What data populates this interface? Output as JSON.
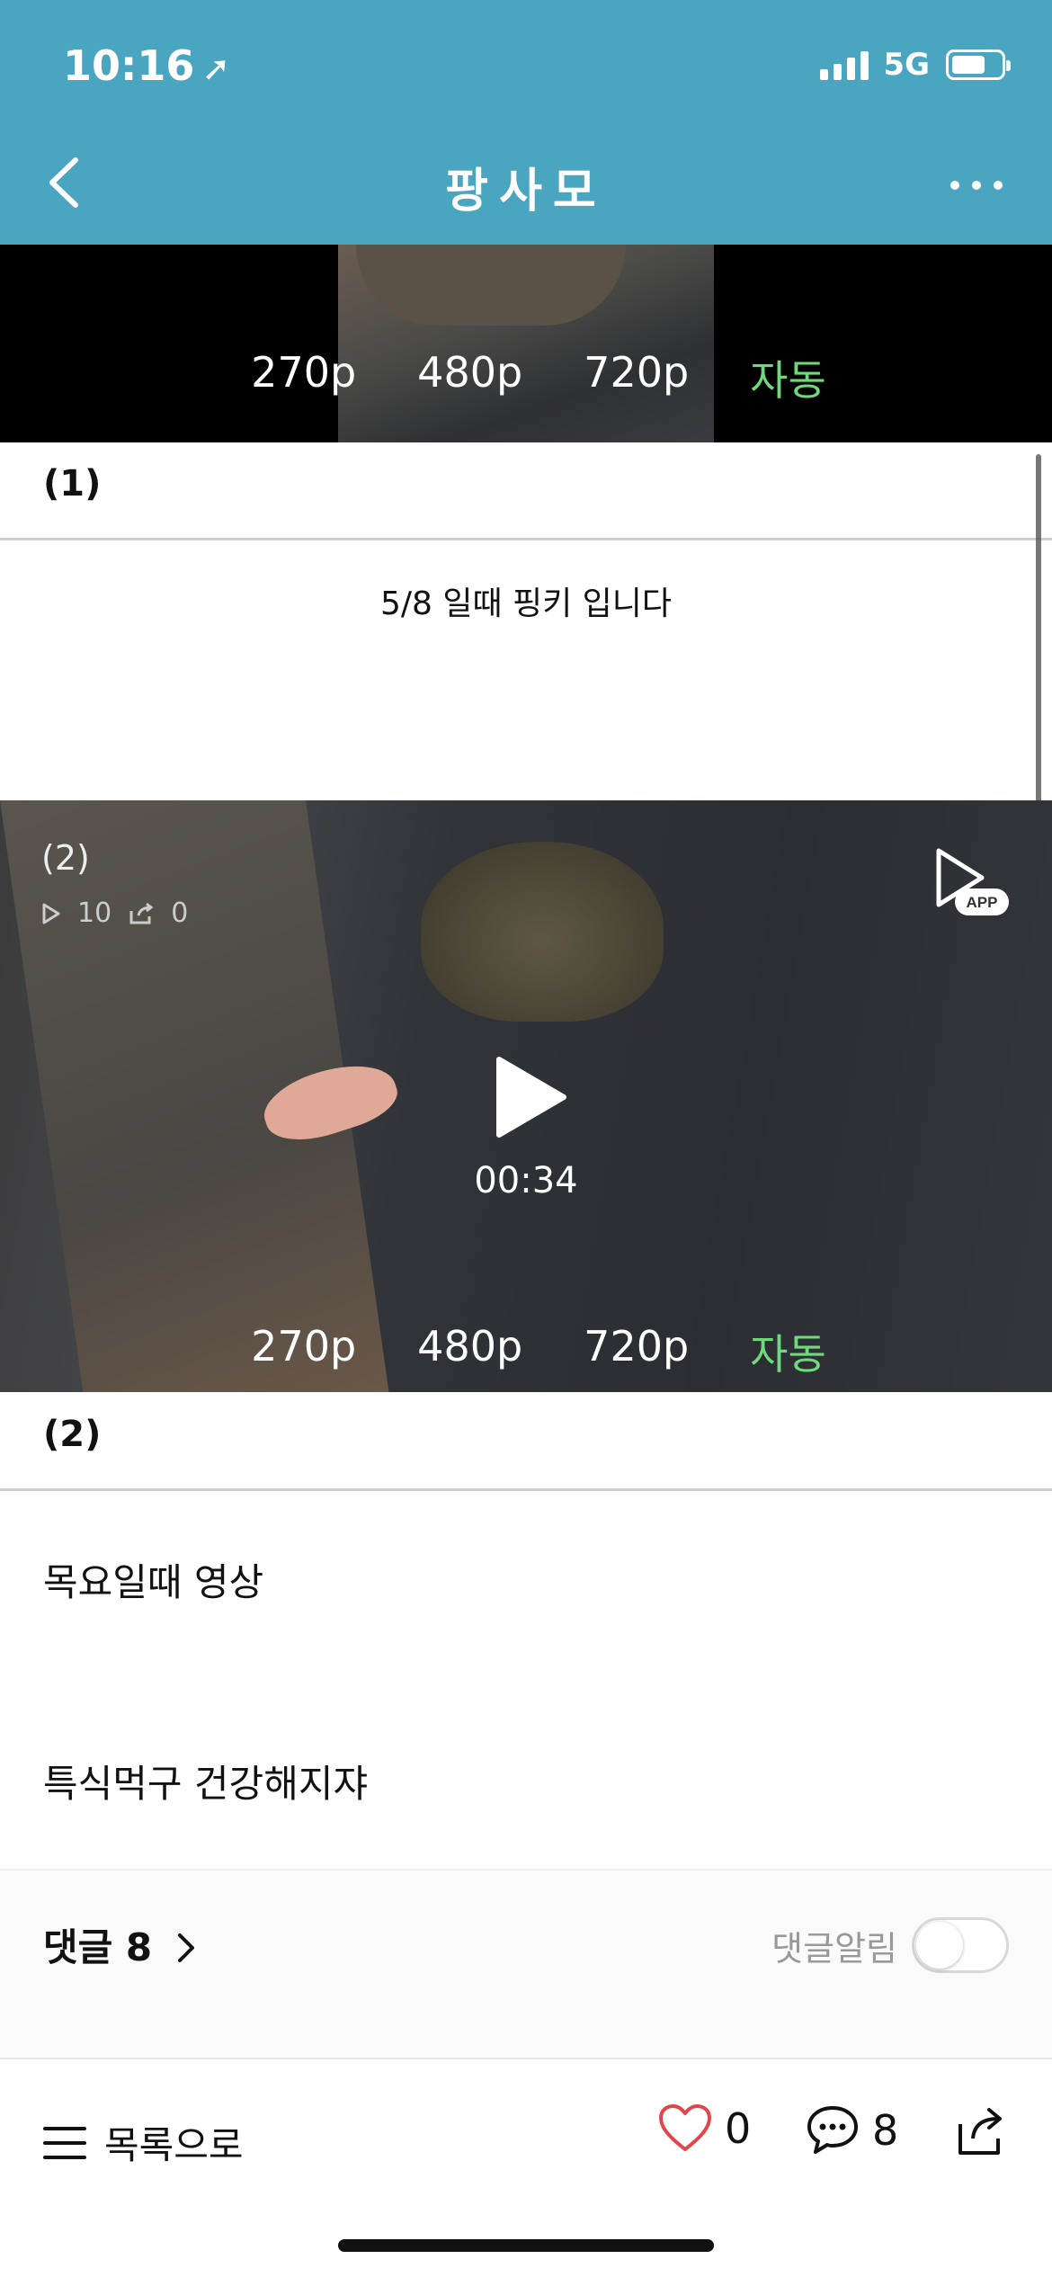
{
  "status_bar": {
    "time": "10:16",
    "network": "5G"
  },
  "nav": {
    "title": "팡사모"
  },
  "video_top": {
    "qualities": [
      "270p",
      "480p",
      "720p"
    ],
    "auto_label": "자동"
  },
  "section1": {
    "label": "(1)",
    "caption": "5/8 일때 핑키 입니다"
  },
  "video_main": {
    "index_label": "(2)",
    "play_count": "10",
    "share_count": "0",
    "app_badge": "APP",
    "duration": "00:34",
    "qualities": [
      "270p",
      "480p",
      "720p"
    ],
    "auto_label": "자동"
  },
  "section2": {
    "label": "(2)",
    "line1": "목요일때 영상",
    "line2": "특식먹구 건강해지쟈"
  },
  "comments": {
    "title": "댓글 8",
    "alert_label": "댓글알림"
  },
  "bottom_bar": {
    "list_label": "목록으로",
    "like_count": "0",
    "comment_count": "8"
  },
  "colors": {
    "header": "#4aa5c1",
    "auto_quality": "#6fda7c",
    "like_heart": "#e0474c"
  }
}
